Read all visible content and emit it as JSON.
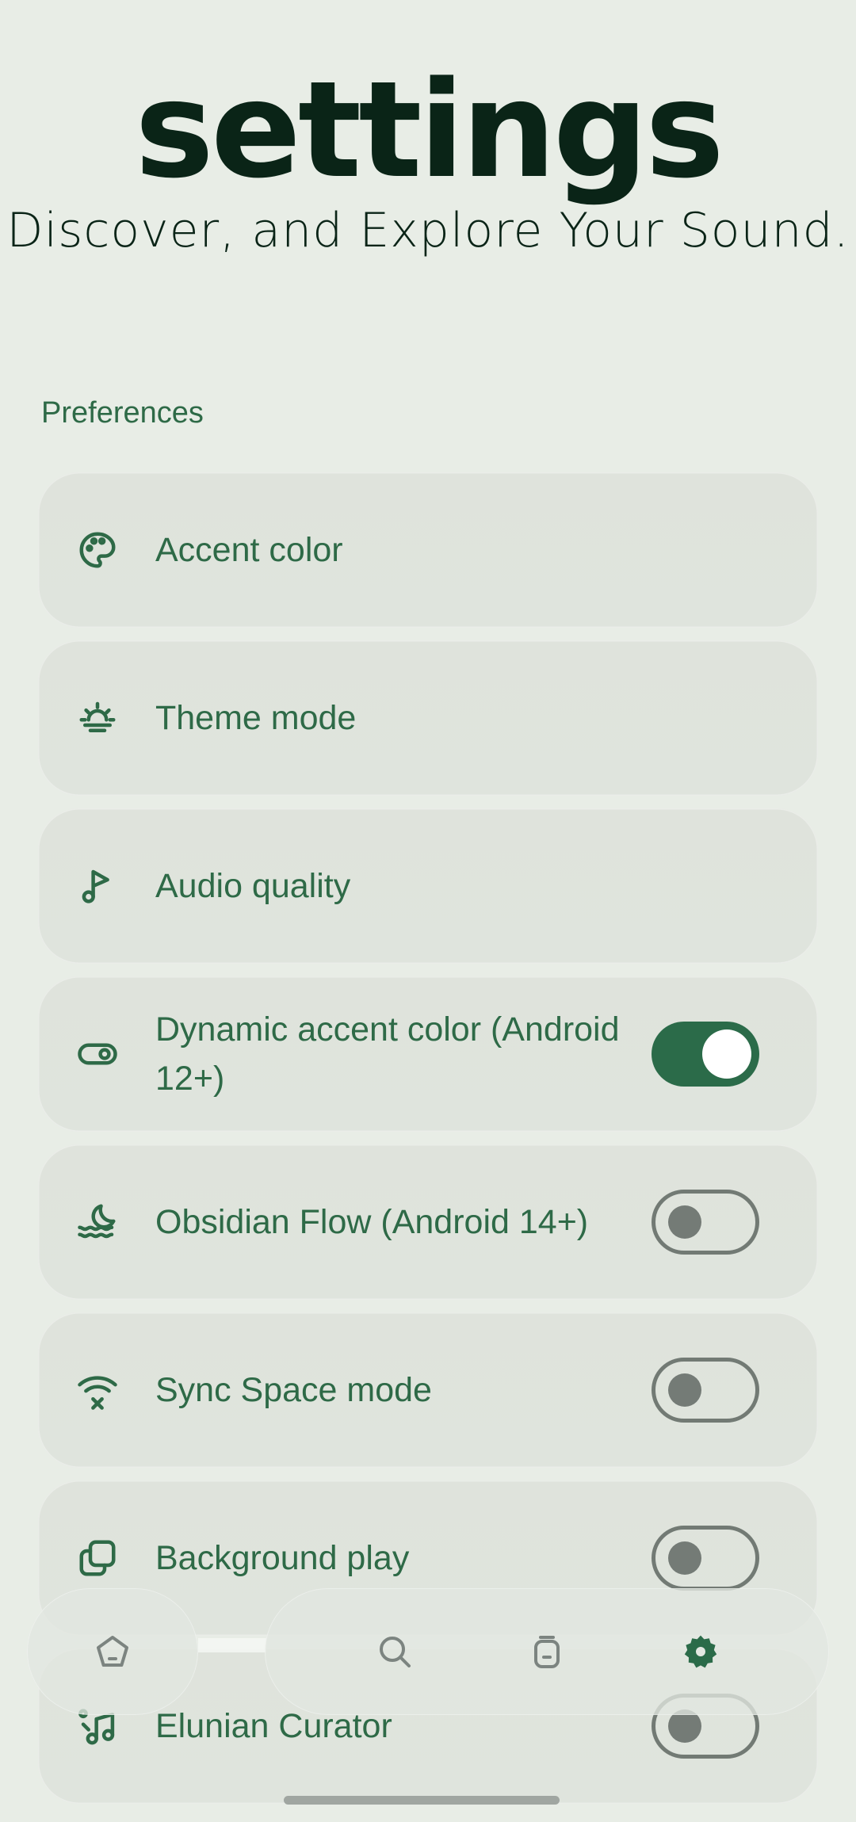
{
  "header": {
    "title": "settings",
    "subtitle": "Discover, and Explore Your Sound."
  },
  "section": {
    "title": "Preferences"
  },
  "items": [
    {
      "label": "Accent color",
      "icon": "palette-icon",
      "toggle": null
    },
    {
      "label": "Theme mode",
      "icon": "sunrise-icon",
      "toggle": null
    },
    {
      "label": "Audio quality",
      "icon": "music-note-icon",
      "toggle": null
    },
    {
      "label": "Dynamic accent color (Android 12+)",
      "icon": "toggle-icon",
      "toggle": "on"
    },
    {
      "label": "Obsidian Flow (Android 14+)",
      "icon": "moon-waves-icon",
      "toggle": "off"
    },
    {
      "label": "Sync Space mode",
      "icon": "wifi-off-icon",
      "toggle": "off"
    },
    {
      "label": "Background play",
      "icon": "copy-icon",
      "toggle": "off"
    },
    {
      "label": "Elunian Curator",
      "icon": "music-list-icon",
      "toggle": "off"
    }
  ],
  "nav": {
    "items": [
      {
        "icon": "home-pentagon-icon",
        "active": false
      },
      {
        "icon": "search-icon",
        "active": false
      },
      {
        "icon": "library-icon",
        "active": false
      },
      {
        "icon": "settings-gear-icon",
        "active": true
      }
    ]
  },
  "colors": {
    "accent": "#2b6b49",
    "text": "#2e6a47",
    "background": "#e8ede6",
    "card": "#dfe3dc",
    "title": "#0a2417"
  }
}
